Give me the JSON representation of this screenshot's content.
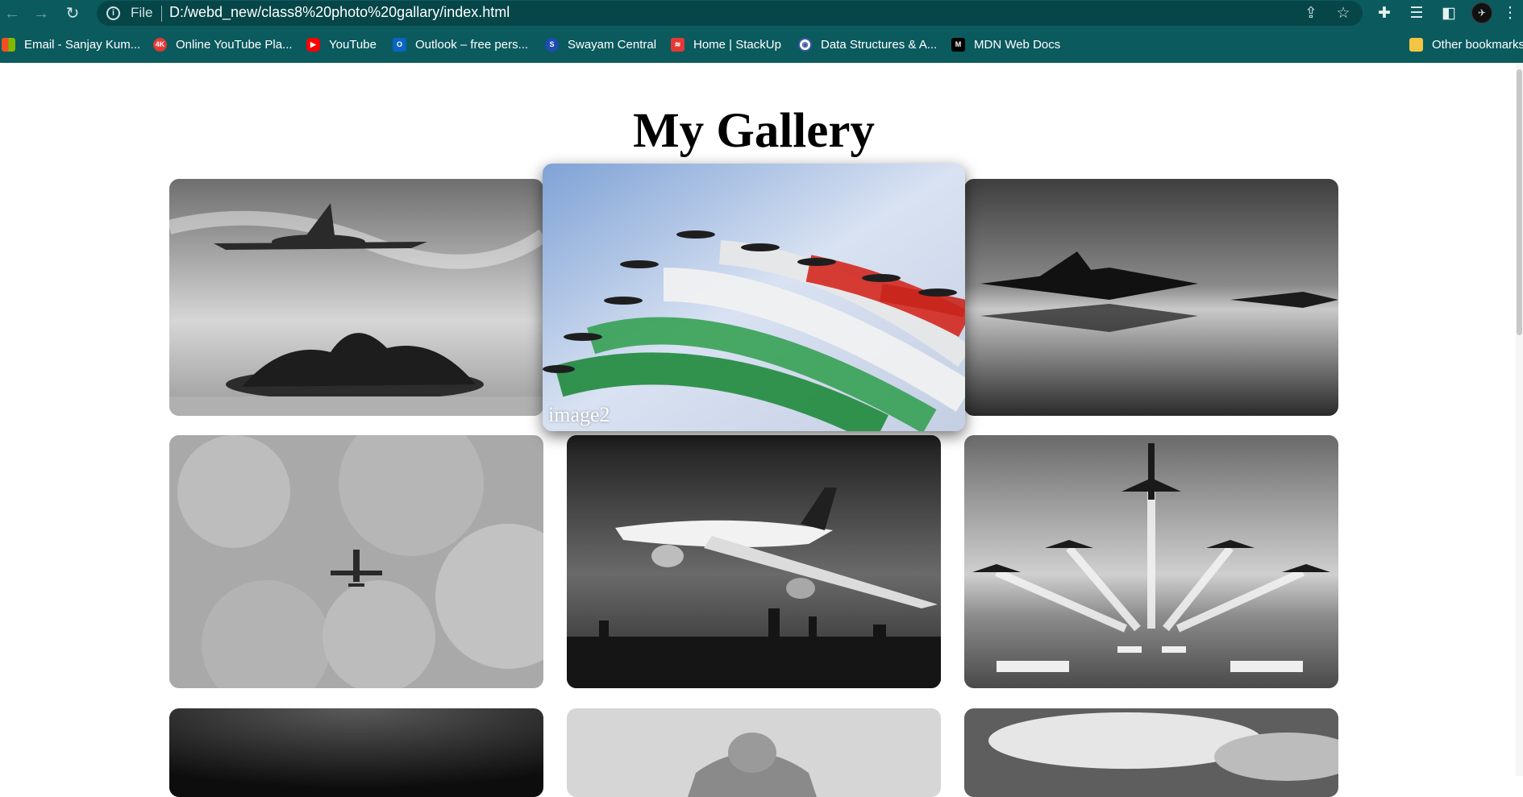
{
  "browser": {
    "address": {
      "scheme_label": "File",
      "url": "D:/webd_new/class8%20photo%20gallary/index.html"
    },
    "bookmarks": [
      {
        "label": "Email - Sanjay Kum...",
        "icon": "microsoft-icon",
        "color": "#f25022"
      },
      {
        "label": "Online YouTube Pla...",
        "icon": "4k-icon",
        "color": "#e53935"
      },
      {
        "label": "YouTube",
        "icon": "youtube-icon",
        "color": "#ff0000"
      },
      {
        "label": "Outlook – free pers...",
        "icon": "outlook-icon",
        "color": "#0a64c2"
      },
      {
        "label": "Swayam Central",
        "icon": "swayam-icon",
        "color": "#1e4bb3"
      },
      {
        "label": "Home | StackUp",
        "icon": "stackup-icon",
        "color": "#e53935"
      },
      {
        "label": "Data Structures & A...",
        "icon": "globe-icon",
        "color": "#3b57a6"
      },
      {
        "label": "MDN Web Docs",
        "icon": "mdn-icon",
        "color": "#000000"
      }
    ],
    "other_bookmarks": {
      "label": "Other bookmarks",
      "icon": "folder-icon",
      "color": "#f4c542"
    }
  },
  "page": {
    "title": "My Gallery",
    "featured_caption": "image2"
  }
}
